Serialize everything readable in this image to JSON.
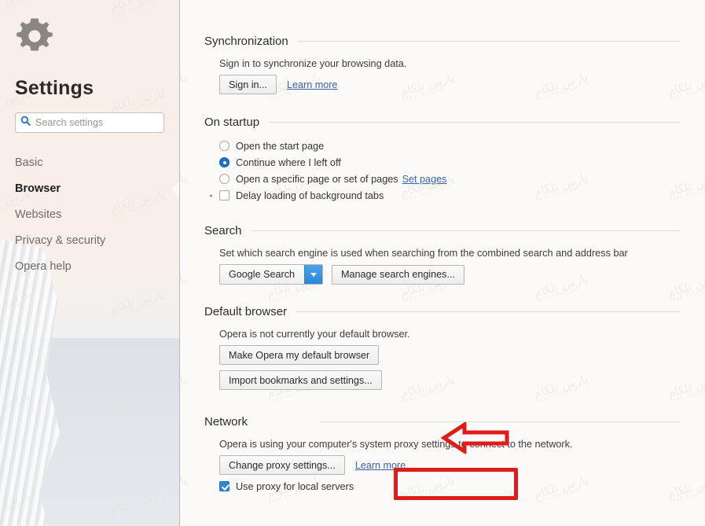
{
  "sidebar": {
    "gear_icon": "gear-icon",
    "title": "Settings",
    "search": {
      "icon": "search-icon",
      "placeholder": "Search settings",
      "value": ""
    },
    "items": [
      {
        "label": "Basic",
        "active": false
      },
      {
        "label": "Browser",
        "active": true
      },
      {
        "label": "Websites",
        "active": false
      },
      {
        "label": "Privacy & security",
        "active": false
      },
      {
        "label": "Opera help",
        "active": false
      }
    ]
  },
  "sections": {
    "synchronization": {
      "heading": "Synchronization",
      "description": "Sign in to synchronize your browsing data.",
      "sign_in_button": "Sign in...",
      "learn_more_link": "Learn more"
    },
    "on_startup": {
      "heading": "On startup",
      "options": [
        {
          "label": "Open the start page",
          "selected": false
        },
        {
          "label": "Continue where I left off",
          "selected": true
        },
        {
          "label": "Open a specific page or set of pages",
          "selected": false,
          "link": "Set pages"
        }
      ],
      "delay_checkbox": {
        "label": "Delay loading of background tabs",
        "checked": false
      }
    },
    "search": {
      "heading": "Search",
      "description": "Set which search engine is used when searching from the combined search and address bar",
      "engine_selected": "Google Search",
      "engine_options": [
        "Google Search"
      ],
      "manage_button": "Manage search engines..."
    },
    "default_browser": {
      "heading": "Default browser",
      "description": "Opera is not currently your default browser.",
      "make_default_button": "Make Opera my default browser",
      "import_button": "Import bookmarks and settings..."
    },
    "network": {
      "heading": "Network",
      "description": "Opera is using your computer's system proxy settings to connect to the network.",
      "change_proxy_button": "Change proxy settings...",
      "learn_more_link": "Learn more",
      "local_proxy_checkbox": {
        "label": "Use proxy for local servers",
        "checked": true
      }
    }
  },
  "annotations": {
    "arrow": {
      "name": "red-left-arrow",
      "color": "#e01b1b",
      "points_to": "Network"
    },
    "highlight_box": {
      "name": "red-highlight-box",
      "color": "#e01b1b",
      "around": "Change proxy settings..."
    }
  },
  "watermark": {
    "text_fa": "پارس تلکام",
    "text_en": "PARS TELECOM",
    "color": "#e3e1dd"
  },
  "colors": {
    "accent_blue": "#2b86d6",
    "link_blue": "#3a62a8",
    "sidebar_bg": "#f8ece6",
    "content_bg": "#fbfaf8",
    "annotation_red": "#e01b1b"
  }
}
